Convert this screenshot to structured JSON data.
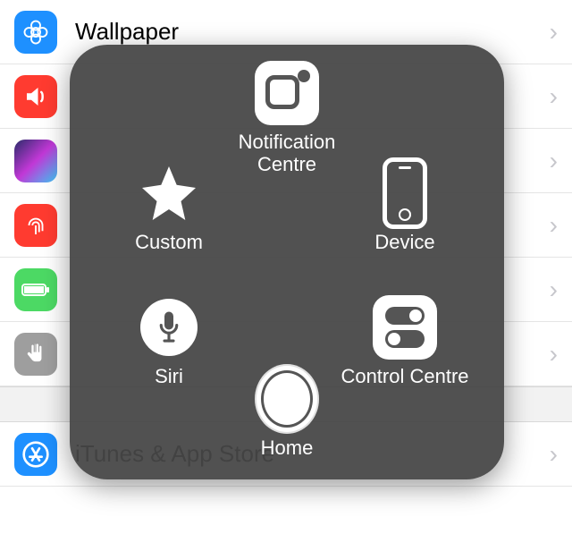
{
  "settings_rows": [
    {
      "key": "wallpaper",
      "label": "Wallpaper"
    },
    {
      "key": "sounds",
      "label": ""
    },
    {
      "key": "siri",
      "label": ""
    },
    {
      "key": "touchid",
      "label": ""
    },
    {
      "key": "battery",
      "label": ""
    },
    {
      "key": "privacy",
      "label": ""
    },
    {
      "key": "appstore",
      "label": "iTunes & App Store"
    }
  ],
  "assistive": {
    "notification": "Notification Centre",
    "custom": "Custom",
    "device": "Device",
    "siri": "Siri",
    "control": "Control Centre",
    "home": "Home"
  }
}
